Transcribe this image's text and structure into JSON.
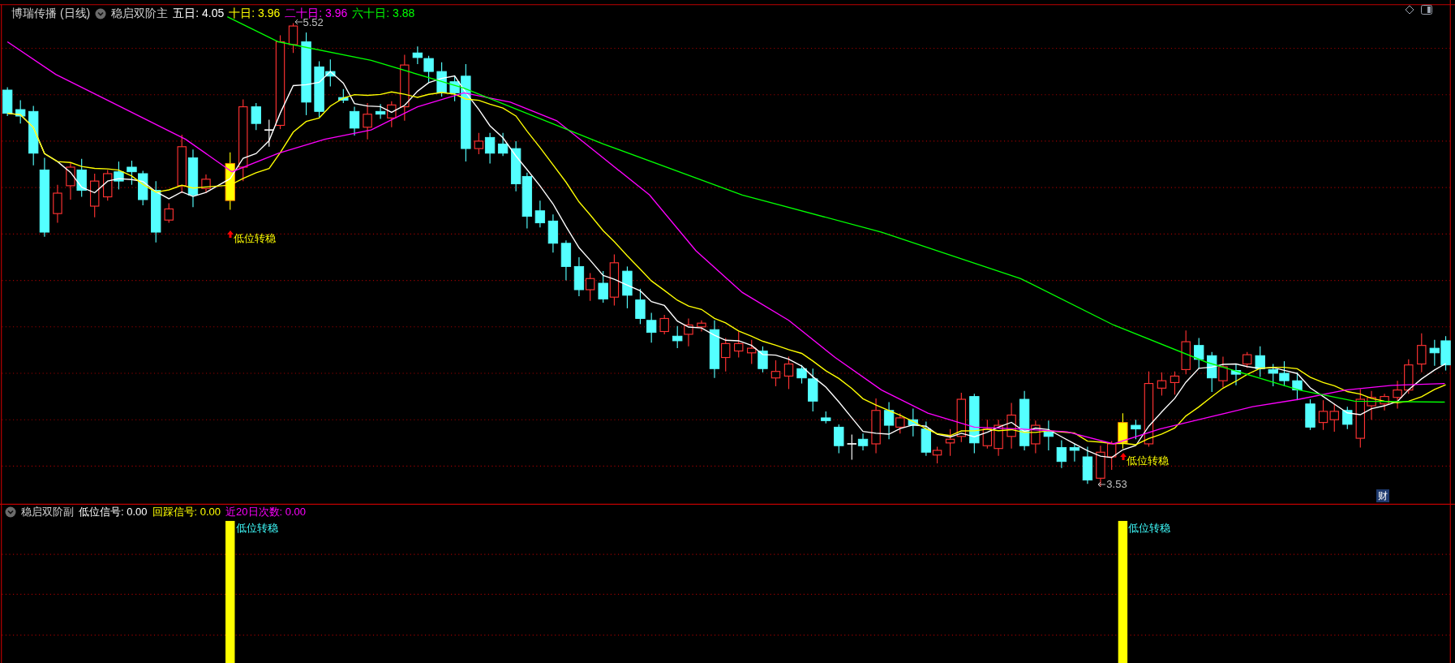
{
  "main": {
    "header": {
      "security": "博瑞传播",
      "period": "(日线)",
      "indicator": "稳启双阶主",
      "averages": [
        {
          "label": "五日:",
          "value": "4.05",
          "color": "#ffffff"
        },
        {
          "label": "十日:",
          "value": "3.96",
          "color": "#ffff00"
        },
        {
          "label": "二十日:",
          "value": "3.96",
          "color": "#ff00ff"
        },
        {
          "label": "六十日:",
          "value": "3.88",
          "color": "#00ff00"
        }
      ]
    },
    "price_marks": [
      {
        "kind": "high",
        "label": "5.52"
      },
      {
        "kind": "low",
        "label": "3.53"
      }
    ],
    "signals": [
      {
        "label": "低位转稳"
      },
      {
        "label": "低位转稳"
      }
    ],
    "badge": "财"
  },
  "sub": {
    "header": {
      "indicator": "稳启双阶副",
      "values": [
        {
          "label": "低位信号:",
          "value": "0.00",
          "color": "#ffffff"
        },
        {
          "label": "回踩信号:",
          "value": "0.00",
          "color": "#ffff00"
        },
        {
          "label": "近20日次数:",
          "value": "0.00",
          "color": "#ff00ff"
        }
      ]
    },
    "signals": [
      {
        "label": "低位转稳"
      },
      {
        "label": "低位转稳"
      }
    ]
  }
}
